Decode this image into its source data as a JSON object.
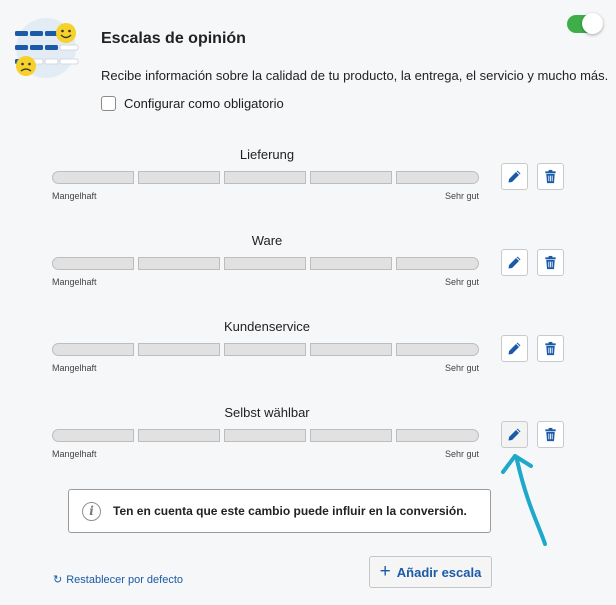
{
  "header": {
    "title": "Escalas de opinión",
    "description": "Recibe información sobre la calidad de tu producto, la entrega, el servicio y mucho más.",
    "enabled": true
  },
  "options": {
    "mandatory_label": "Configurar como obligatorio",
    "mandatory_checked": false
  },
  "scales": [
    {
      "title": "Lieferung",
      "low_label": "Mangelhaft",
      "high_label": "Sehr gut"
    },
    {
      "title": "Ware",
      "low_label": "Mangelhaft",
      "high_label": "Sehr gut"
    },
    {
      "title": "Kundenservice",
      "low_label": "Mangelhaft",
      "high_label": "Sehr gut"
    },
    {
      "title": "Selbst wählbar",
      "low_label": "Mangelhaft",
      "high_label": "Sehr gut"
    }
  ],
  "notice": {
    "icon": "info-icon",
    "text": "Ten en cuenta que este cambio puede influir en la conversión."
  },
  "footer": {
    "reset_label": "Restablecer por defecto",
    "add_label": "Añadir escala"
  },
  "colors": {
    "accent": "#1b5aa6",
    "toggle_on": "#3fae49",
    "annotation_arrow": "#1fa8c9"
  }
}
